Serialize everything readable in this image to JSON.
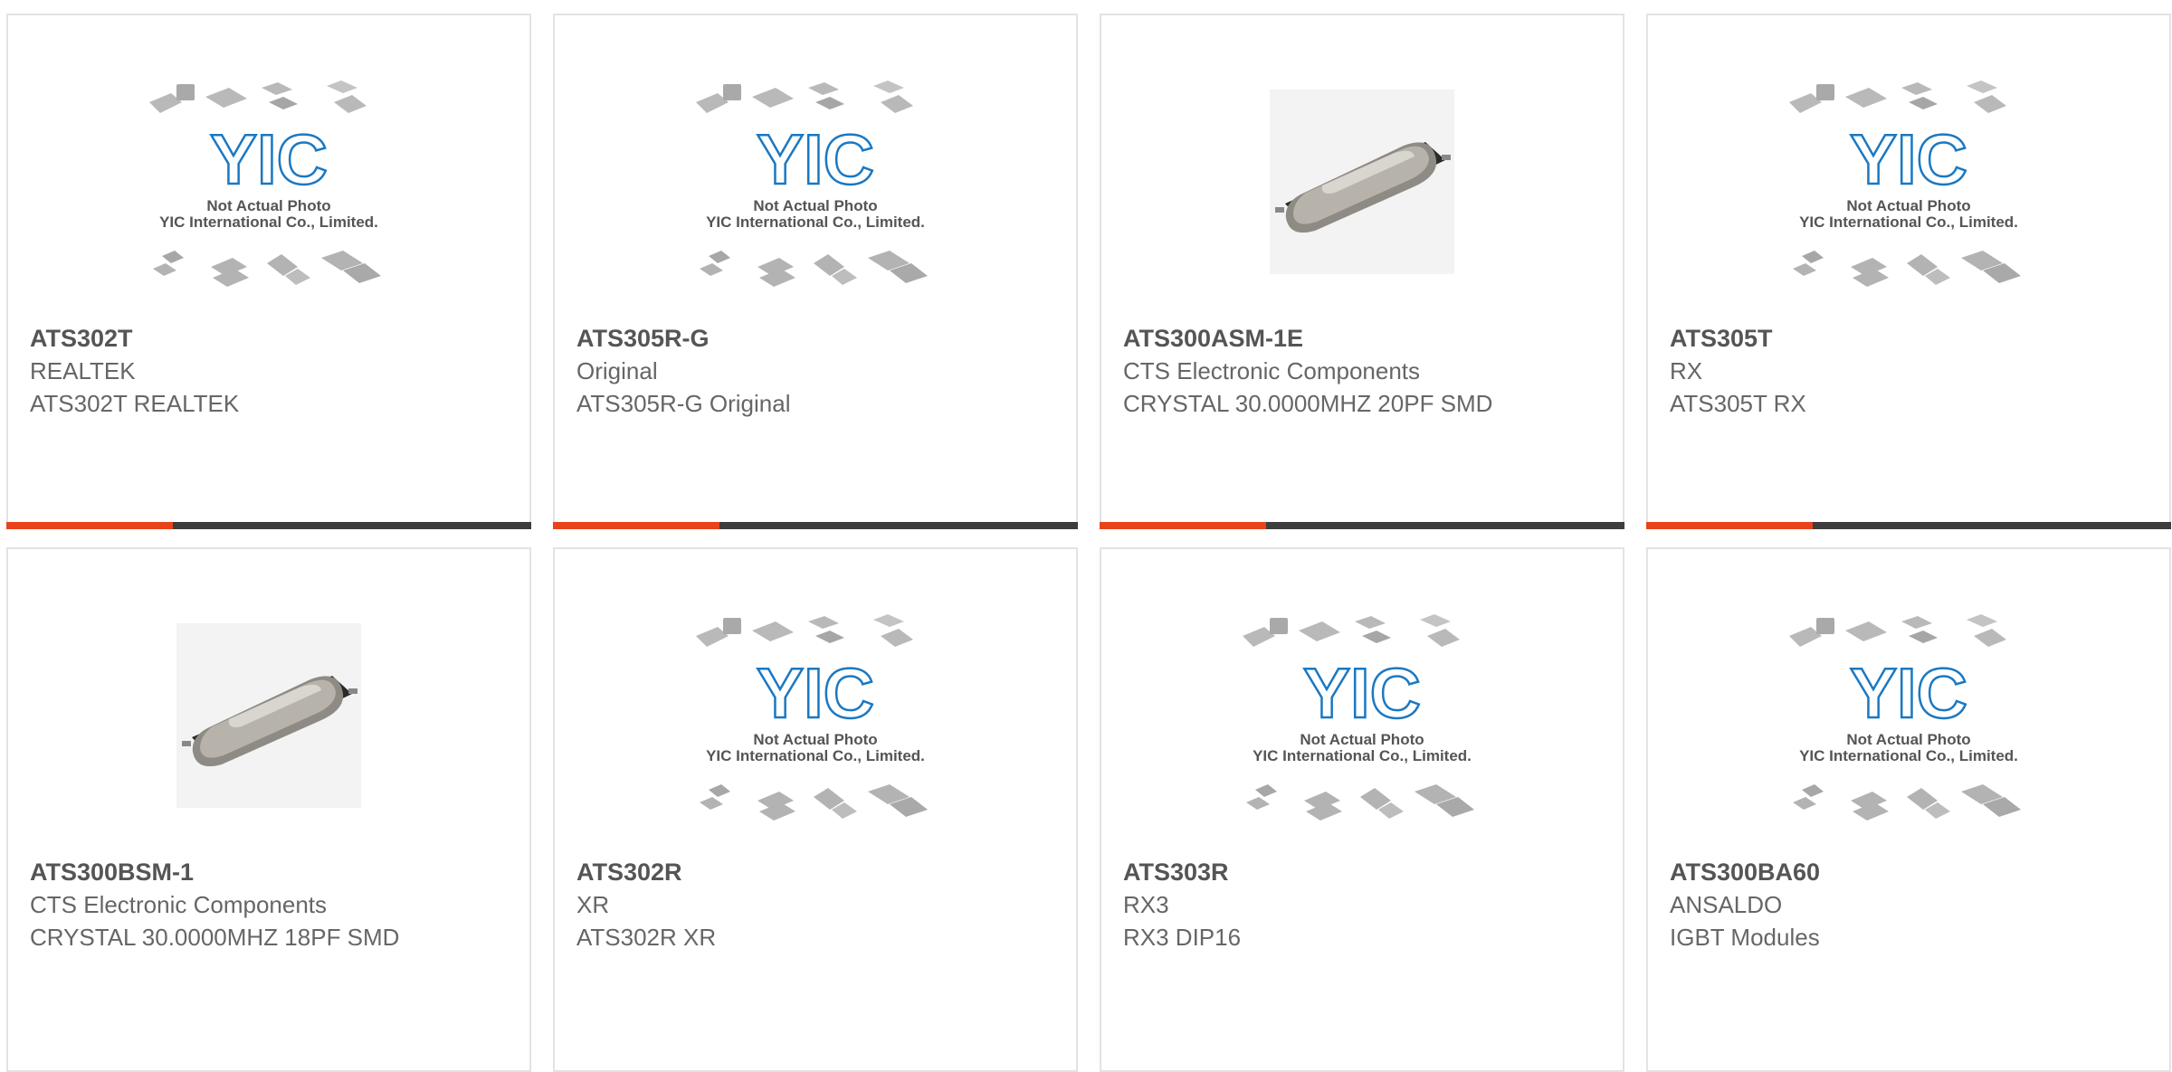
{
  "placeholder": {
    "logo_text": "YIC",
    "line1": "Not Actual Photo",
    "line2": "YIC International Co., Limited."
  },
  "colors": {
    "accent": "#e8431b",
    "bar": "#3d3d3d",
    "logo": "#1a78c2"
  },
  "products": [
    {
      "pn": "ATS302T",
      "mfr": "REALTEK",
      "desc": "ATS302T REALTEK",
      "image": "placeholder"
    },
    {
      "pn": "ATS305R-G",
      "mfr": "Original",
      "desc": "ATS305R-G Original",
      "image": "placeholder"
    },
    {
      "pn": "ATS300ASM-1E",
      "mfr": "CTS Electronic Components",
      "desc": "CRYSTAL 30.0000MHZ 20PF SMD",
      "image": "crystal"
    },
    {
      "pn": "ATS305T",
      "mfr": "RX",
      "desc": "ATS305T RX",
      "image": "placeholder"
    },
    {
      "pn": "ATS300BSM-1",
      "mfr": "CTS Electronic Components",
      "desc": "CRYSTAL 30.0000MHZ 18PF SMD",
      "image": "crystal"
    },
    {
      "pn": "ATS302R",
      "mfr": "XR",
      "desc": "ATS302R XR",
      "image": "placeholder"
    },
    {
      "pn": "ATS303R",
      "mfr": "RX3",
      "desc": "RX3 DIP16",
      "image": "placeholder"
    },
    {
      "pn": "ATS300BA60",
      "mfr": "ANSALDO",
      "desc": "IGBT Modules",
      "image": "placeholder"
    }
  ]
}
